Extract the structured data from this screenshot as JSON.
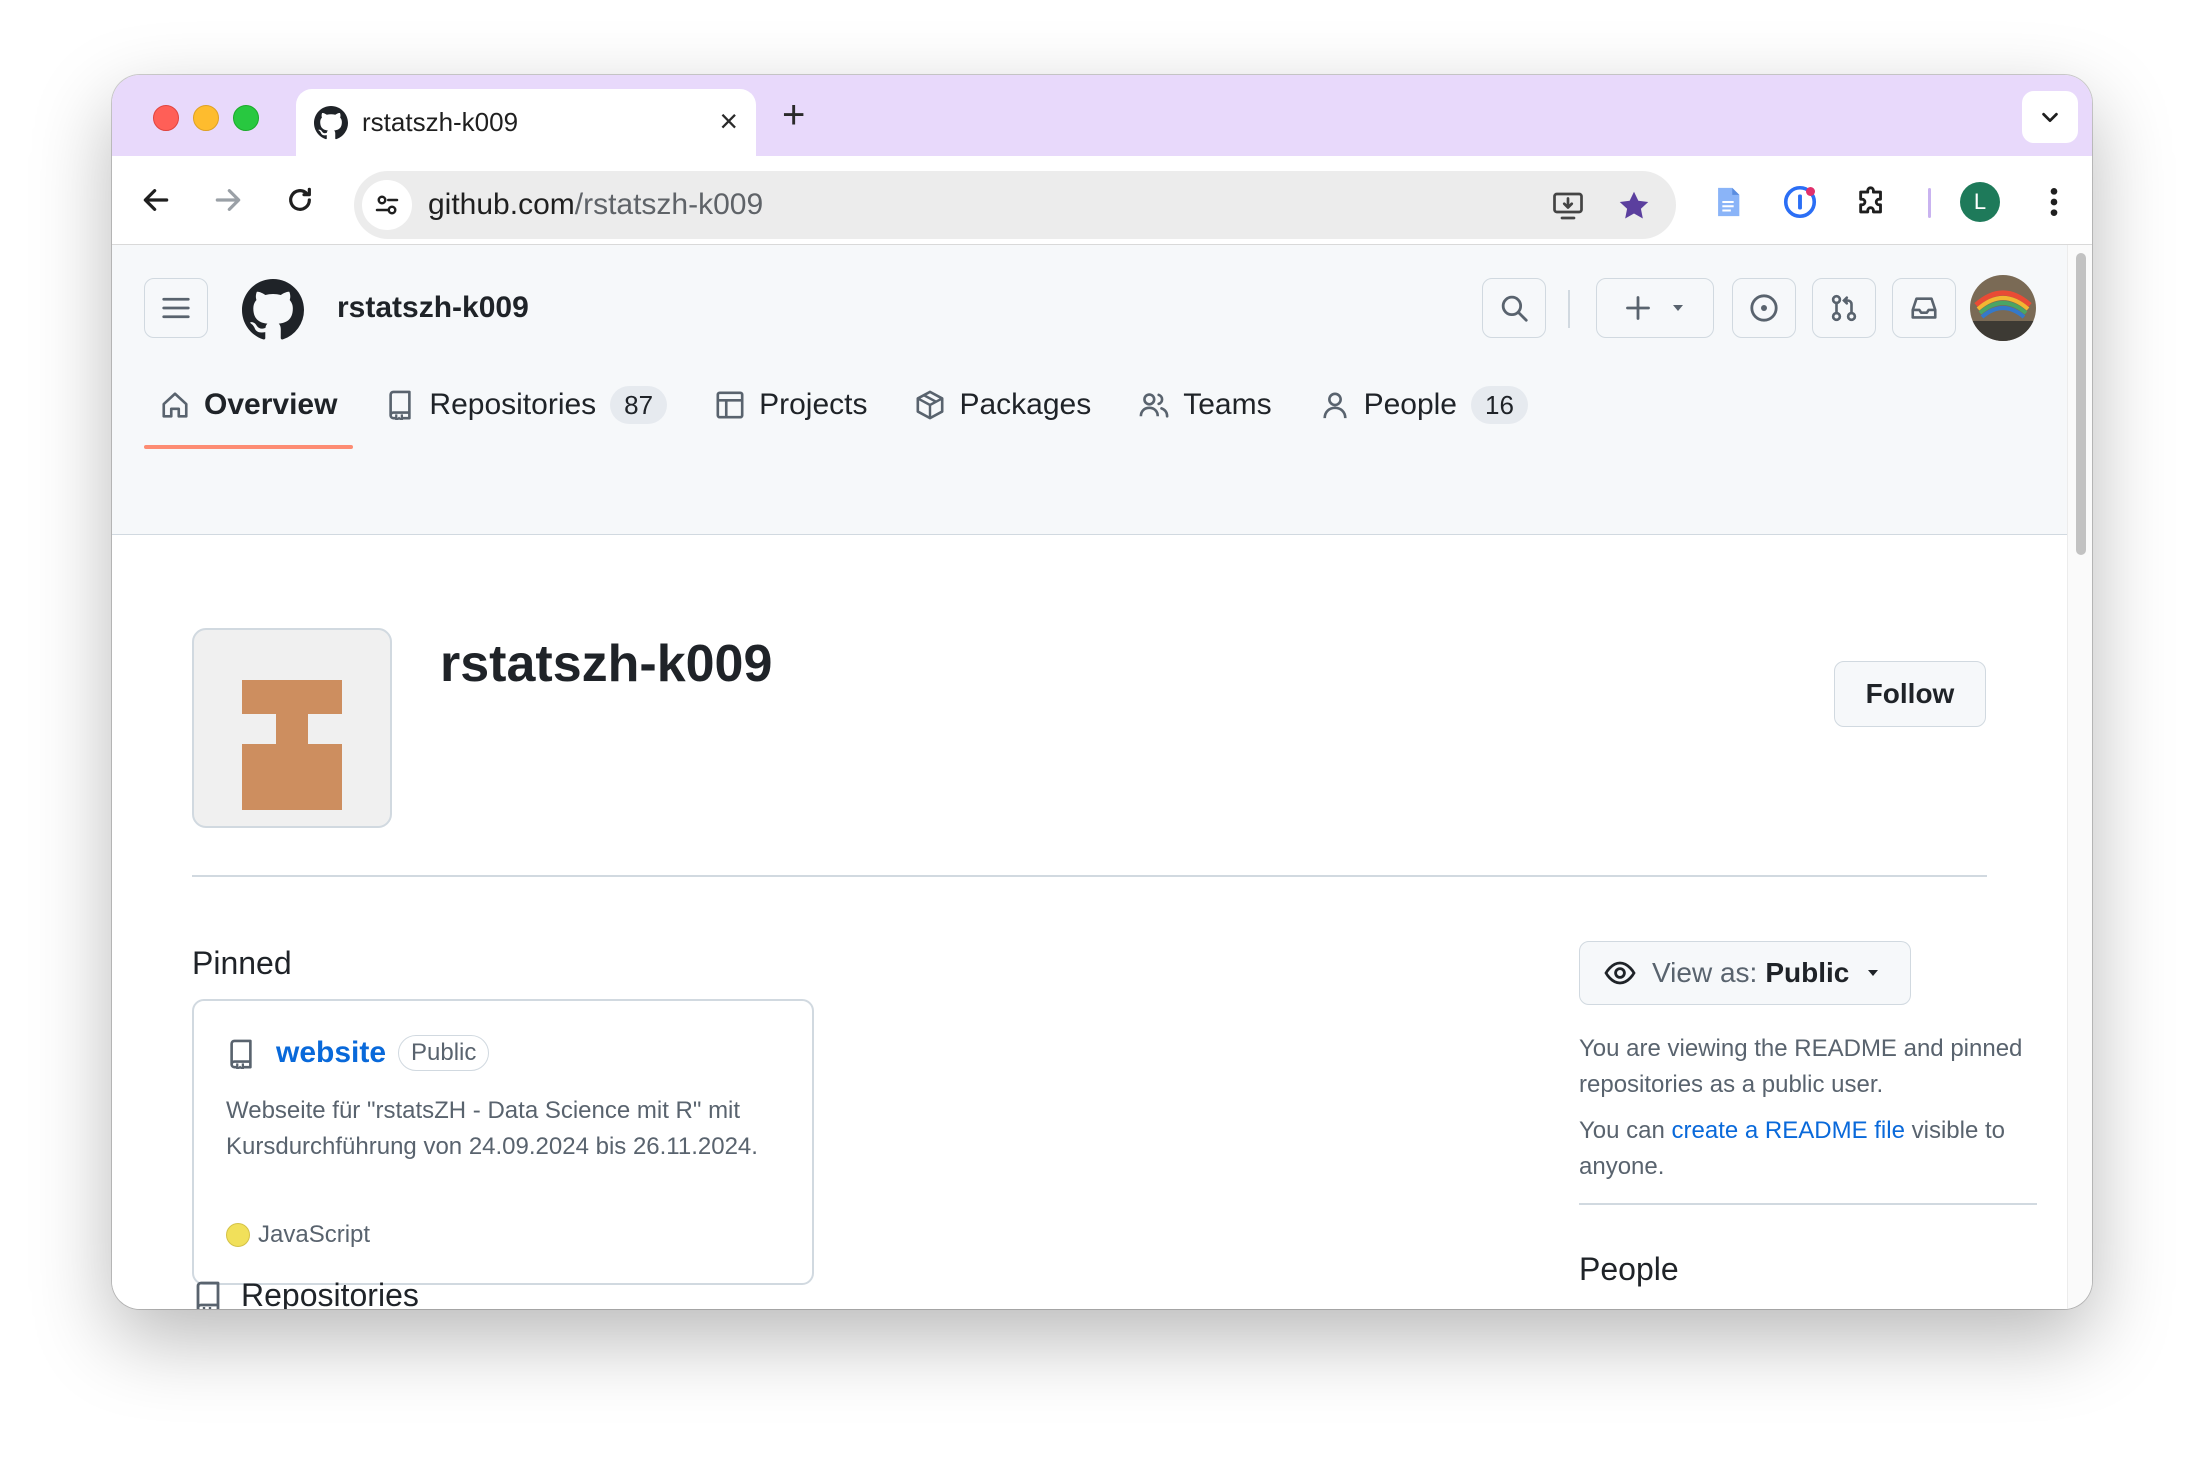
{
  "browser": {
    "tab_title": "rstatszh-k009",
    "url_host": "github.com",
    "url_path": "/rstatszh-k009",
    "profile_initial": "L",
    "accent": "#e8d9fb"
  },
  "header": {
    "org_name": "rstatszh-k009"
  },
  "nav": {
    "overview": "Overview",
    "repositories": "Repositories",
    "repositories_count": "87",
    "projects": "Projects",
    "packages": "Packages",
    "teams": "Teams",
    "people": "People",
    "people_count": "16"
  },
  "profile": {
    "title": "rstatszh-k009",
    "follow_label": "Follow"
  },
  "pinned": {
    "heading": "Pinned",
    "repo_name": "website",
    "visibility": "Public",
    "description": "Webseite für \"rstatsZH - Data Science mit R\" mit Kursdurchführung von 24.09.2024 bis 26.11.2024.",
    "language": "JavaScript",
    "language_color": "#f1e05a"
  },
  "repositories": {
    "heading": "Repositories"
  },
  "sidebar": {
    "view_as_label": "View as:",
    "view_as_value": "Public",
    "readme_note": "You are viewing the README and pinned repositories as a public user.",
    "create_prefix": "You can ",
    "create_link": "create a README file",
    "create_suffix": " visible to anyone.",
    "people_heading": "People"
  }
}
